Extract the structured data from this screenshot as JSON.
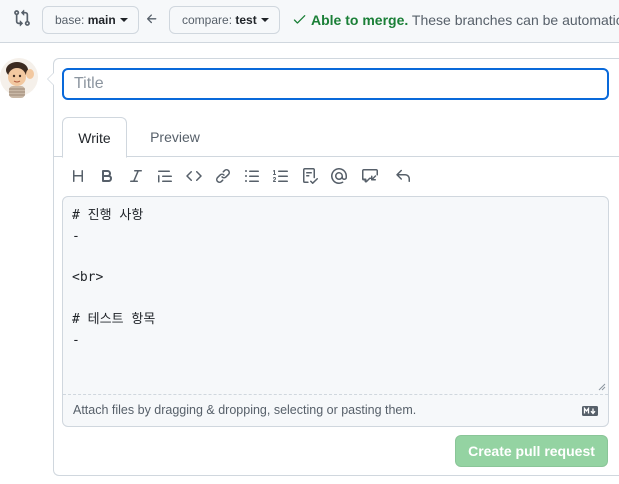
{
  "topbar": {
    "base_label": "base:",
    "base_value": "main",
    "compare_label": "compare:",
    "compare_value": "test",
    "merge_status": "Able to merge.",
    "merge_description": "These branches can be automatically merged."
  },
  "form": {
    "title_placeholder": "Title",
    "title_value": ""
  },
  "tabs": [
    {
      "label": "Write",
      "active": true
    },
    {
      "label": "Preview",
      "active": false
    }
  ],
  "toolbar_icons": [
    "heading-icon",
    "bold-icon",
    "italic-icon",
    "quote-icon",
    "code-icon",
    "link-icon",
    "unordered-list-icon",
    "ordered-list-icon",
    "task-list-icon",
    "mention-icon",
    "reference-icon",
    "undo-icon"
  ],
  "editor": {
    "body": "# 진행 사항\n-\n\n<br>\n\n# 테스트 항목\n-",
    "attach_hint": "Attach files by dragging & dropping, selecting or pasting them."
  },
  "actions": {
    "create_label": "Create pull request"
  },
  "colors": {
    "accent": "#0969da",
    "success": "#1a7f37",
    "create_disabled": "#94d3a2"
  }
}
